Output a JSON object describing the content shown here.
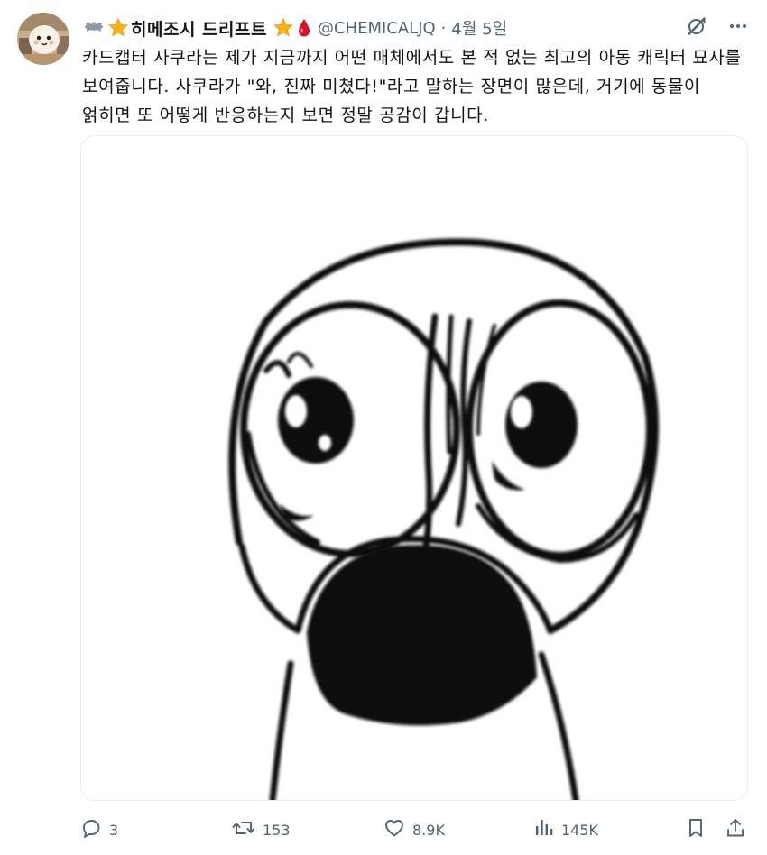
{
  "author": {
    "display_name": "히메조시 드리프트",
    "handle": "@CHEMICALJQ",
    "separator": "·",
    "date": "4월 5일",
    "avatar_icon": "avatar-photo",
    "badge_icons": [
      "bat-emoji-icon",
      "star-emoji-icon",
      "star-emoji-icon",
      "blood-drop-emoji-icon"
    ]
  },
  "header_actions": {
    "grok_icon": "grok-icon",
    "more_icon": "more-icon"
  },
  "tweet": {
    "text": "카드캡터 사쿠라는 제가 지금까지 어떤 매체에서도 본 적 없는 최고의 아동 캐릭터 묘사를 보여줍니다. 사쿠라가 \"와, 진짜 미쳤다!\"라고 말하는 장면이 많은데, 거기에 동물이 얽히면 또 어떻게 반응하는지 보면 정말 공감이 갑니다."
  },
  "media": {
    "kind": "image",
    "subject": "shocked-face-drawing"
  },
  "actions": {
    "reply": {
      "icon": "reply-icon",
      "count": "3"
    },
    "repost": {
      "icon": "repost-icon",
      "count": "153"
    },
    "like": {
      "icon": "like-icon",
      "count": "8.9K"
    },
    "views": {
      "icon": "views-icon",
      "count": "145K"
    },
    "bookmark": {
      "icon": "bookmark-icon"
    },
    "share": {
      "icon": "share-icon"
    }
  },
  "colors": {
    "text_primary": "#0f1419",
    "text_secondary": "#536471",
    "border": "#e6ecf0",
    "star": "#f6b21a",
    "blood": "#d4142a"
  }
}
